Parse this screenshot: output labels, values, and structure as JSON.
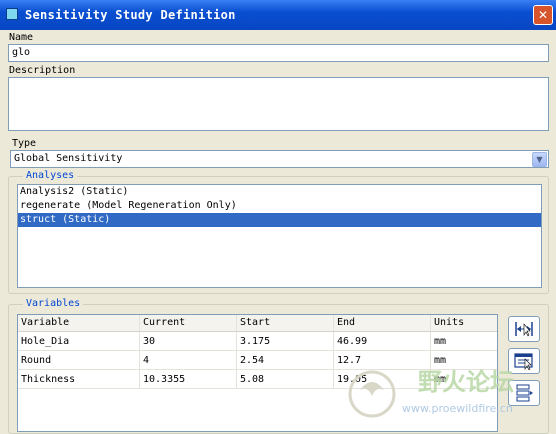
{
  "window": {
    "title": "Sensitivity Study Definition",
    "close_glyph": "✕"
  },
  "name": {
    "label": "Name",
    "value": "glo"
  },
  "description": {
    "label": "Description",
    "value": ""
  },
  "type": {
    "label": "Type",
    "value": "Global Sensitivity",
    "arrow_icon": "chevron-down-icon"
  },
  "analyses": {
    "legend": "Analyses",
    "items": [
      "Analysis2 (Static)",
      "regenerate (Model Regeneration Only)",
      "struct (Static)"
    ],
    "selected_index": 2
  },
  "variables": {
    "legend": "Variables",
    "columns": [
      "Variable",
      "Current",
      "Start",
      "End",
      "Units"
    ],
    "rows": [
      [
        "Hole_Dia",
        "30",
        "3.175",
        "46.99",
        "mm"
      ],
      [
        "Round",
        "4",
        "2.54",
        "12.7",
        "mm"
      ],
      [
        "Thickness",
        "10.3355",
        "5.08",
        "19.05",
        "mm"
      ]
    ]
  },
  "tools": [
    "select-dimension-icon",
    "select-parameter-icon",
    "options-icon"
  ],
  "watermark": {
    "brand": "野火论坛",
    "url": "www.proewildfire.cn"
  },
  "colors": {
    "titlebar": "#0a4fd1",
    "selection": "#316ac5",
    "legend": "#0046d5",
    "background": "#ece9d8"
  }
}
